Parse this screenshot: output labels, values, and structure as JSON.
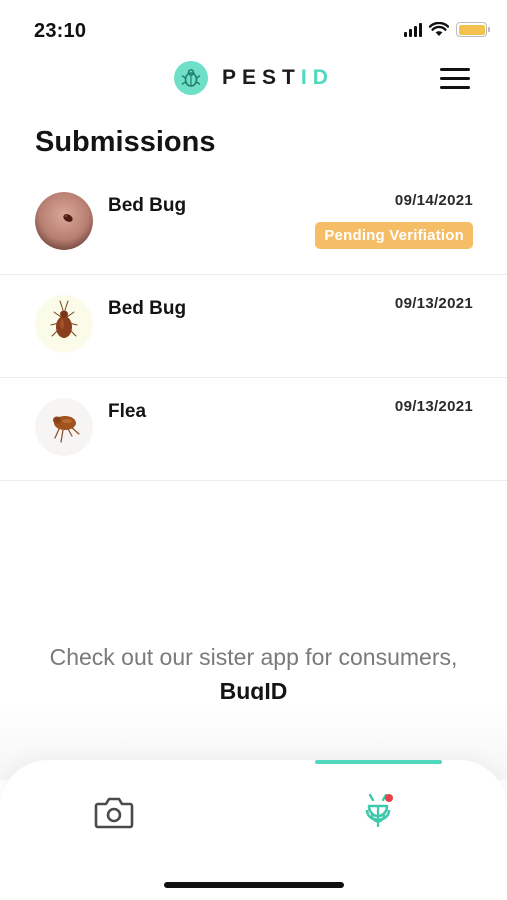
{
  "status_bar": {
    "time": "23:10"
  },
  "header": {
    "logo_main": "PEST",
    "logo_accent": "ID"
  },
  "page": {
    "title": "Submissions"
  },
  "submissions": [
    {
      "name": "Bed Bug",
      "date": "09/14/2021",
      "status": "Pending Verifiation",
      "thumb": "bed-bug-on-skin"
    },
    {
      "name": "Bed Bug",
      "date": "09/13/2021",
      "status": "",
      "thumb": "bed-bug"
    },
    {
      "name": "Flea",
      "date": "09/13/2021",
      "status": "",
      "thumb": "flea"
    }
  ],
  "promo": {
    "text": "Check out our sister app for consumers,",
    "app_name": "BugID"
  },
  "tabs": [
    {
      "icon": "camera-icon",
      "active": false
    },
    {
      "icon": "bug-icon",
      "active": true,
      "notification": true
    }
  ],
  "colors": {
    "accent": "#4fd8bd",
    "badge": "#f5bd66",
    "notification": "#e8424a"
  }
}
